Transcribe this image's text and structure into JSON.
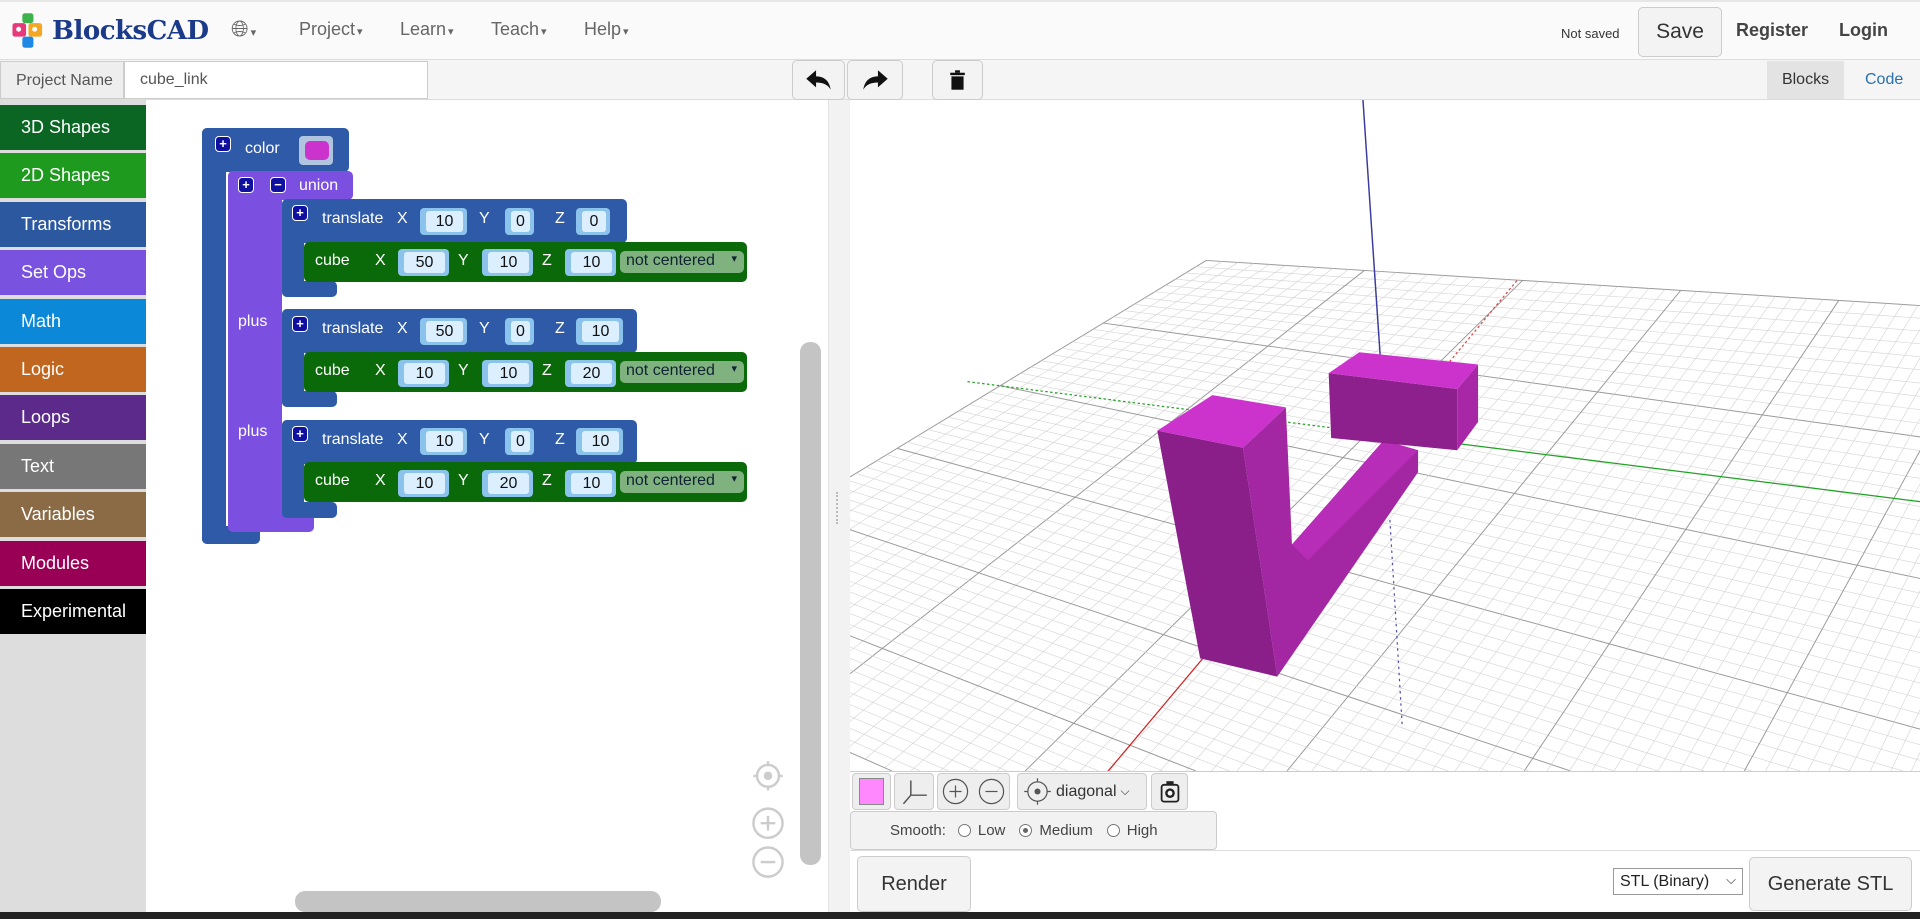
{
  "header": {
    "logo": "BlocksCAD",
    "globe_icon": "globe-icon",
    "nav": [
      "Project",
      "Learn",
      "Teach",
      "Help"
    ],
    "save_status": "Not saved",
    "save": "Save",
    "register": "Register",
    "login": "Login"
  },
  "project": {
    "label": "Project Name",
    "value": "cube_link"
  },
  "tabs": {
    "blocks": "Blocks",
    "code": "Code"
  },
  "sidebar": [
    {
      "label": "3D Shapes",
      "color": "#0b6623"
    },
    {
      "label": "2D Shapes",
      "color": "#1e9a1e"
    },
    {
      "label": "Transforms",
      "color": "#2c58a0"
    },
    {
      "label": "Set Ops",
      "color": "#7a52e0"
    },
    {
      "label": "Math",
      "color": "#0b88d8"
    },
    {
      "label": "Logic",
      "color": "#c0661f"
    },
    {
      "label": "Loops",
      "color": "#5b2a8a"
    },
    {
      "label": "Text",
      "color": "#777777"
    },
    {
      "label": "Variables",
      "color": "#8b6b46"
    },
    {
      "label": "Modules",
      "color": "#990055"
    },
    {
      "label": "Experimental",
      "color": "#000000"
    }
  ],
  "blocks": {
    "color": {
      "label": "color",
      "swatch": "#cc33cc"
    },
    "union": {
      "label": "union",
      "plus": "plus"
    },
    "translate_label": "translate",
    "cube_label": "cube",
    "axes": [
      "X",
      "Y",
      "Z"
    ],
    "items": [
      {
        "translate": [
          "10",
          "0",
          "0"
        ],
        "cube": [
          "50",
          "10",
          "10"
        ],
        "center": "not centered"
      },
      {
        "translate": [
          "50",
          "0",
          "10"
        ],
        "cube": [
          "10",
          "10",
          "20"
        ],
        "center": "not centered"
      },
      {
        "translate": [
          "10",
          "0",
          "10"
        ],
        "cube": [
          "10",
          "20",
          "10"
        ],
        "center": "not centered"
      }
    ]
  },
  "viewer": {
    "model_color": "#cc33cc",
    "view": "diagonal",
    "smooth_label": "Smooth:",
    "smooth_options": [
      "Low",
      "Medium",
      "High"
    ],
    "smooth_selected": "Medium",
    "swatch": "#ff88ff"
  },
  "bottom": {
    "render": "Render",
    "format": "STL (Binary)",
    "generate": "Generate STL"
  }
}
